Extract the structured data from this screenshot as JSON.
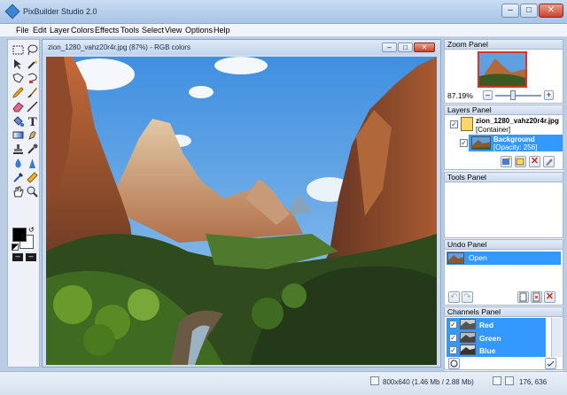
{
  "window": {
    "title": "PixBuilder Studio 2.0"
  },
  "menu": [
    "File",
    "Edit",
    "Layer",
    "Colors",
    "Effects",
    "Tools",
    "Select",
    "View",
    "Options",
    "Help"
  ],
  "document": {
    "title": "zion_1280_vahz20r4r.jpg (87%) - RGB colors"
  },
  "toolbox": {
    "tools": [
      "rect-select",
      "lasso",
      "move",
      "magic-wand",
      "polygon-lasso",
      "magnetic-lasso",
      "pencil",
      "brush",
      "eraser",
      "line",
      "fill",
      "text",
      "gradient",
      "smudge",
      "clone-stamp",
      "dropper-tool",
      "blur",
      "sharpen",
      "eyedropper",
      "ruler",
      "hand",
      "zoom"
    ],
    "colors": {
      "foreground": "#000000",
      "background": "#ffffff"
    }
  },
  "zoom_panel": {
    "title": "Zoom Panel",
    "zoom": "87.19%",
    "level": 0.38
  },
  "layers_panel": {
    "title": "Layers Panel",
    "container": {
      "name": "zion_1280_vahz20r4r.jpg",
      "type": "[Container]"
    },
    "layer": {
      "name": "Background",
      "info": "[Opacity: 256]"
    }
  },
  "tools_panel": {
    "title": "Tools Panel"
  },
  "undo_panel": {
    "title": "Undo Panel",
    "items": [
      "Open"
    ]
  },
  "channels_panel": {
    "title": "Channels Panel",
    "channels": [
      "Red",
      "Green",
      "Blue"
    ]
  },
  "status": {
    "size": "800x640 (1.46 Mb / 2.88 Mb)",
    "coords": "176, 636"
  }
}
